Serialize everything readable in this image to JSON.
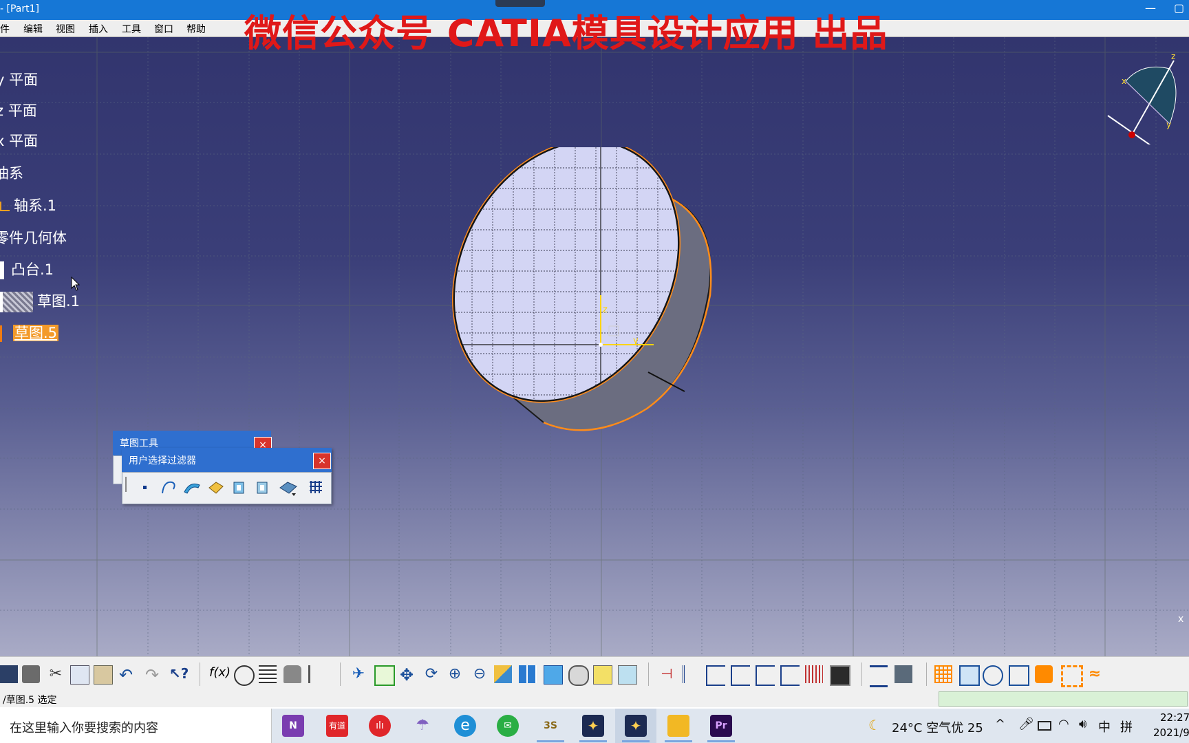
{
  "window": {
    "title": "- [Part1]",
    "min": "—",
    "max": "▢"
  },
  "menu": [
    "件",
    "编辑",
    "视图",
    "插入",
    "工具",
    "窗口",
    "帮助"
  ],
  "watermark": "微信公众号 CATIA模具设计应用 出品",
  "tree": {
    "items": [
      {
        "label": "y 平面"
      },
      {
        "label": "z 平面"
      },
      {
        "label": "x 平面"
      },
      {
        "label": "油系"
      },
      {
        "label": "轴系.1"
      },
      {
        "label": "零件几何体"
      },
      {
        "label": "凸台.1"
      },
      {
        "label": "草图.1"
      },
      {
        "label": "草图.5",
        "selected": true
      }
    ]
  },
  "compass": {
    "axes": [
      "x",
      "y",
      "z"
    ]
  },
  "model_axis": {
    "labels": [
      "z",
      "y"
    ]
  },
  "corner_axis_label": "x",
  "toolbox_sketch": {
    "title": "草图工具",
    "close": "×"
  },
  "toolbox_filter": {
    "title": "用户选择过滤器",
    "close": "×",
    "icons": [
      "point-filter-icon",
      "curve-filter-icon",
      "surface-filter-icon",
      "volume-filter-icon",
      "feature-element-filter-icon",
      "geometrical-element-filter-icon",
      "intersection-icon",
      "quick-select-grid-icon"
    ]
  },
  "bottom_toolbar": {
    "icons": [
      "save-icon",
      "print-icon",
      "cut-icon",
      "copy-icon",
      "paste-icon",
      "undo-icon",
      "redo-icon",
      "whats-this-icon",
      "formula-icon",
      "comment-icon",
      "table-icon",
      "lock-icon",
      "catalog-icon",
      "fly-mode-icon",
      "fit-all-icon",
      "pan-icon",
      "rotate-icon",
      "zoom-in-icon",
      "zoom-out-icon",
      "normal-view-icon",
      "multi-view-icon",
      "iso-view-icon",
      "render-style-icon",
      "hide-show-icon",
      "swap-visible-icon",
      "constraint-icon",
      "dimension-icon",
      "analysis-icon",
      "analysis-2-icon",
      "analysis-3-icon",
      "analysis-4-icon",
      "curvature-icon",
      "parameter-icon",
      "measure-icon",
      "inertia-icon",
      "grid-icon",
      "snap-icon",
      "sketch-icon",
      "sketch-tools-icon",
      "transform-icon",
      "constraint-2-icon",
      "fix-icon"
    ],
    "accent": "#ff8a00"
  },
  "status": {
    "message": "/草图.5 选定"
  },
  "taskbar": {
    "search_placeholder": "在这里输入你要搜索的内容",
    "apps": [
      {
        "name": "onenote-icon",
        "text": "N",
        "color": "#7a3db0"
      },
      {
        "name": "youdao-icon",
        "text": "有道",
        "color": "#e0262a"
      },
      {
        "name": "music-icon",
        "text": "ılı",
        "color": "#e0262a"
      },
      {
        "name": "parachute-icon",
        "text": "☂",
        "color": "#8060c0"
      },
      {
        "name": "edge-icon",
        "text": "e",
        "color": "#1f8fd6"
      },
      {
        "name": "wechat-icon",
        "text": "✉",
        "color": "#2aae44"
      },
      {
        "name": "3ds-icon",
        "text": "3S",
        "color": "#4a4a4a"
      },
      {
        "name": "catia-icon-1",
        "text": "✦",
        "color": "#1c2a52"
      },
      {
        "name": "catia-icon-2",
        "text": "✦",
        "color": "#1c2a52"
      },
      {
        "name": "folder-icon",
        "text": "▬",
        "color": "#f2b824"
      },
      {
        "name": "premiere-icon",
        "text": "Pr",
        "color": "#2a0b4f"
      }
    ],
    "weather": "24°C 空气优 25",
    "ime": "中",
    "ime2": "拼",
    "time": "22:27",
    "date": "2021/9"
  }
}
